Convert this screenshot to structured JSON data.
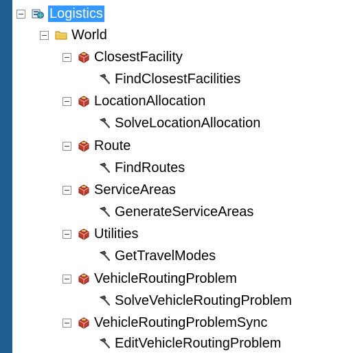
{
  "tree": {
    "root": {
      "label": "Logistics",
      "selected": true
    },
    "folder": {
      "label": "World"
    },
    "services": [
      {
        "label": "ClosestFacility",
        "tool": "FindClosestFacilities"
      },
      {
        "label": "LocationAllocation",
        "tool": "SolveLocationAllocation"
      },
      {
        "label": "Route",
        "tool": "FindRoutes"
      },
      {
        "label": "ServiceAreas",
        "tool": "GenerateServiceAreas"
      },
      {
        "label": "Utilities",
        "tool": "GetTravelModes"
      },
      {
        "label": "VehicleRoutingProblem",
        "tool": "SolveVehicleRoutingProblem"
      },
      {
        "label": "VehicleRoutingProblemSync",
        "tool": "EditVehicleRoutingProblem"
      }
    ]
  },
  "colors": {
    "background": "#1f5f92",
    "panel": "#ffffff",
    "selection": "#3399ff",
    "folder": "#f2c94c",
    "toolbox": "#c0392b"
  },
  "icons": {
    "root": "server-connection-icon",
    "folder": "folder-icon",
    "service": "geoprocessing-toolbox-icon",
    "tool": "hammer-tool-icon"
  }
}
